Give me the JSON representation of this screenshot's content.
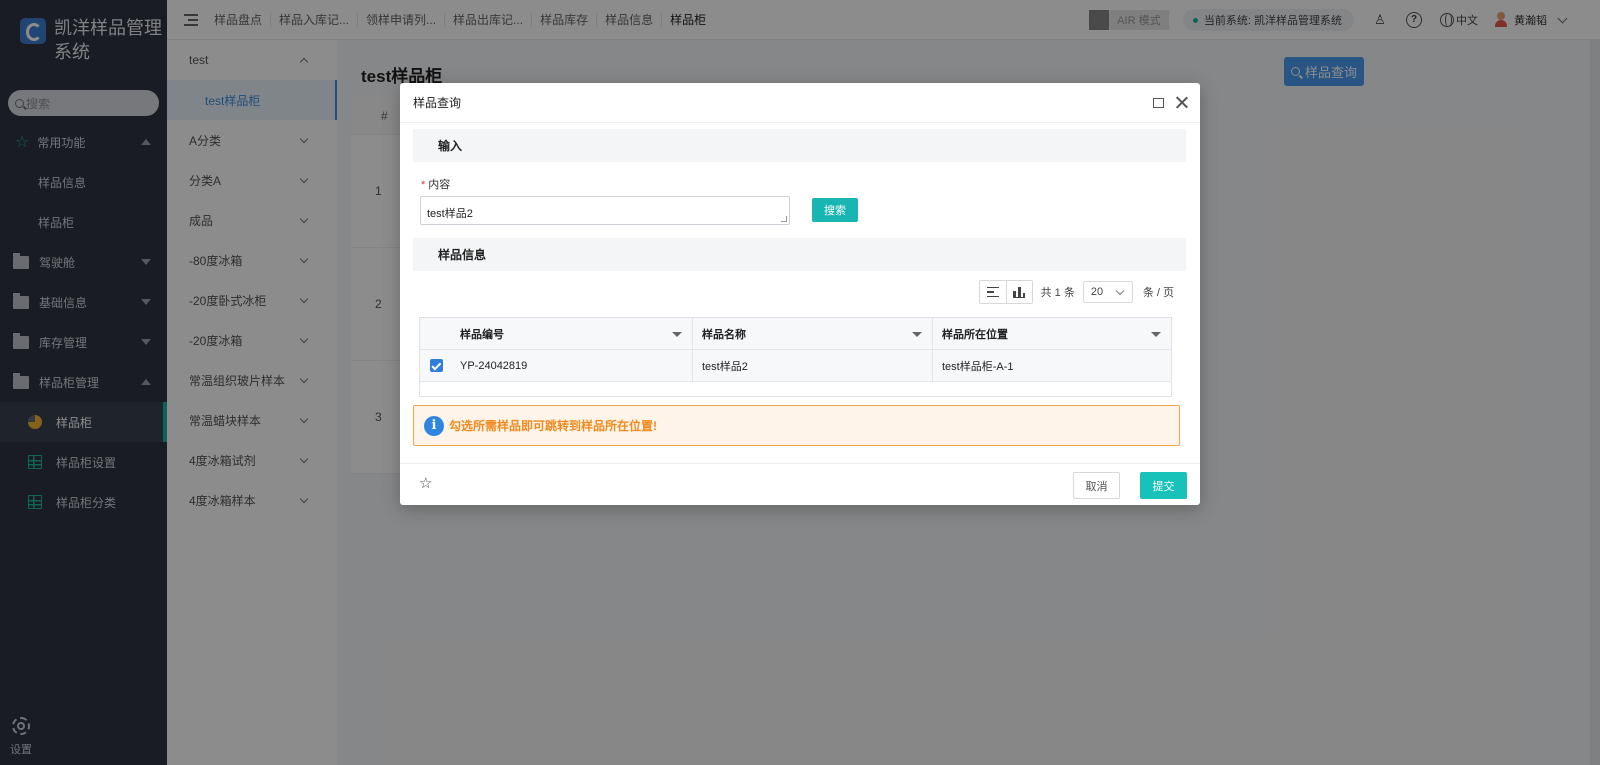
{
  "sidebar": {
    "brand_title": "凯洋样品管理系统",
    "search_placeholder": "搜索",
    "groups": [
      {
        "label": "常用功能",
        "expanded": true,
        "subitems": [
          "样品信息",
          "样品柜"
        ]
      },
      {
        "label": "驾驶舱",
        "expanded": false
      },
      {
        "label": "基础信息",
        "expanded": false
      },
      {
        "label": "库存管理",
        "expanded": false
      },
      {
        "label": "样品柜管理",
        "expanded": true,
        "subitems": [
          "样品柜",
          "样品柜设置",
          "样品柜分类"
        ]
      }
    ],
    "settings_label": "设置"
  },
  "topbar": {
    "breadcrumbs": [
      "样品盘点",
      "样品入库记...",
      "领样申请列...",
      "样品出库记...",
      "样品库存",
      "样品信息",
      "样品柜"
    ],
    "air_mode": "AIR 模式",
    "current_system": "当前系统: 凯洋样品管理系统",
    "language": "中文",
    "username": "黄瀚韬"
  },
  "tree": {
    "items": [
      {
        "label": "test",
        "expanded": true
      },
      {
        "label": "test样品柜",
        "selected": true
      },
      {
        "label": "A分类"
      },
      {
        "label": "分类A"
      },
      {
        "label": "成品"
      },
      {
        "label": "-80度冰箱"
      },
      {
        "label": "-20度卧式冰柜"
      },
      {
        "label": "-20度冰箱"
      },
      {
        "label": "常温组织玻片样本"
      },
      {
        "label": "常温蜡块样本"
      },
      {
        "label": "4度冰箱试剂"
      },
      {
        "label": "4度冰箱样本"
      }
    ]
  },
  "main": {
    "page_title": "test样品柜",
    "query_button": "样品查询",
    "table_hash": "#",
    "rows": [
      "1",
      "2",
      "3"
    ]
  },
  "dialog": {
    "title": "样品查询",
    "input_section": "输入",
    "content_label": "内容",
    "content_value": "test样品2",
    "search_button": "搜索",
    "info_section": "样品信息",
    "total_text": "共 1 条",
    "page_size": "20",
    "per_page_text": "条 / 页",
    "columns": [
      "样品编号",
      "样品名称",
      "样品所在位置"
    ],
    "rows": [
      {
        "code": "YP-24042819",
        "name": "test样品2",
        "location": "test样品柜-A-1",
        "checked": true
      }
    ],
    "notice": "勾选所需样品即可跳转到样品所在位置!",
    "cancel_button": "取消",
    "submit_button": "提交"
  },
  "icons": [
    "search-icon",
    "star-icon",
    "folder-icon",
    "pie-icon",
    "grid-icon",
    "gear-icon",
    "menu-toggle-icon",
    "help-icon",
    "globe-icon",
    "user-avatar-icon",
    "maximize-icon",
    "close-icon",
    "info-icon",
    "sort-icon",
    "bar-chart-icon",
    "favorite-star-icon"
  ],
  "colors": {
    "accent": "#18b6b3",
    "primary": "#2f7fd9",
    "warning": "#f08a1c",
    "sidebar_bg": "#2e3440"
  }
}
